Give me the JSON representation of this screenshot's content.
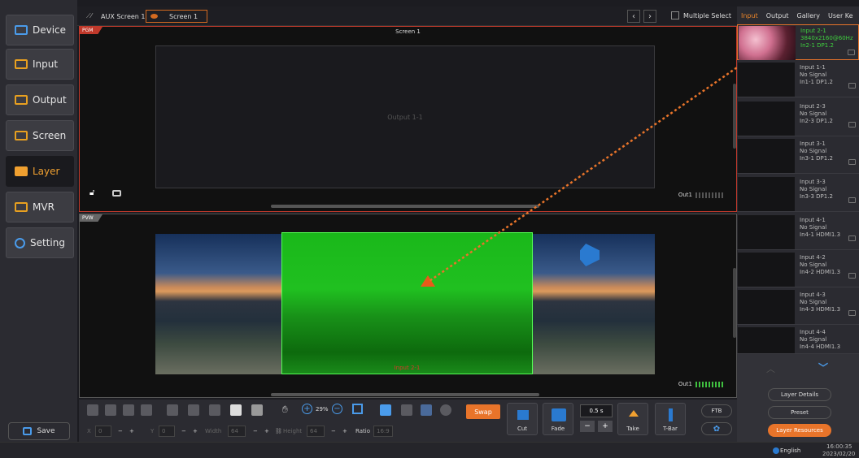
{
  "colors": {
    "accent": "#e8742a",
    "pgm_border": "#c0392b",
    "active_text": "#f0a030",
    "signal_green": "#3fcf3f"
  },
  "sidebar": {
    "items": [
      {
        "label": "Device",
        "icon": "device-icon"
      },
      {
        "label": "Input",
        "icon": "input-icon"
      },
      {
        "label": "Output",
        "icon": "output-icon"
      },
      {
        "label": "Screen",
        "icon": "screen-icon"
      },
      {
        "label": "Layer",
        "icon": "layer-icon",
        "active": true
      },
      {
        "label": "MVR",
        "icon": "mvr-icon"
      },
      {
        "label": "Setting",
        "icon": "gear-icon"
      }
    ],
    "save_label": "Save"
  },
  "topbar": {
    "tabs": [
      "AUX Screen 1",
      "Screen 1"
    ],
    "multiple_select_label": "Multiple Select"
  },
  "pgm": {
    "badge": "PGM",
    "title": "Screen 1",
    "output_box_label": "Output 1-1",
    "output_label": "Out1"
  },
  "pvw": {
    "badge": "PVW",
    "layer_name": "Input 2-1",
    "output_label": "Out1"
  },
  "right_panel": {
    "tabs": [
      "Input",
      "Output",
      "Gallery",
      "User Ke"
    ],
    "sources": [
      {
        "name": "Input 2-1",
        "status": "3840x2160@60Hz",
        "port": "In2-1  DP1.2",
        "has_signal": true
      },
      {
        "name": "Input 1-1",
        "status": "No Signal",
        "port": "In1-1  DP1.2"
      },
      {
        "name": "Input 2-3",
        "status": "No Signal",
        "port": "In2-3  DP1.2"
      },
      {
        "name": "Input 3-1",
        "status": "No Signal",
        "port": "In3-1  DP1.2"
      },
      {
        "name": "Input 3-3",
        "status": "No Signal",
        "port": "In3-3  DP1.2"
      },
      {
        "name": "Input 4-1",
        "status": "No Signal",
        "port": "In4-1  HDMI1.3"
      },
      {
        "name": "Input 4-2",
        "status": "No Signal",
        "port": "In4-2  HDMI1.3"
      },
      {
        "name": "Input 4-3",
        "status": "No Signal",
        "port": "In4-3  HDMI1.3"
      },
      {
        "name": "Input 4-4",
        "status": "No Signal",
        "port": "In4-4  HDMI1.3"
      }
    ],
    "layer_details_label": "Layer Details",
    "preset_label": "Preset",
    "layer_resources_label": "Layer Resources"
  },
  "toolbar": {
    "zoom_label": "29%",
    "swap_label": "Swap",
    "cut_label": "Cut",
    "fade_label": "Fade",
    "duration_value": "0.5 s",
    "take_label": "Take",
    "tbar_label": "T-Bar",
    "ftb_label": "FTB",
    "x_label": "X",
    "x_value": "0",
    "y_label": "Y",
    "y_value": "0",
    "width_label": "Width",
    "width_value": "64",
    "height_label": "Height",
    "height_value": "64",
    "ratio_label": "Ratio",
    "ratio_value": "16:9"
  },
  "status": {
    "language": "English",
    "time": "16:00:35",
    "date": "2023/02/20"
  }
}
